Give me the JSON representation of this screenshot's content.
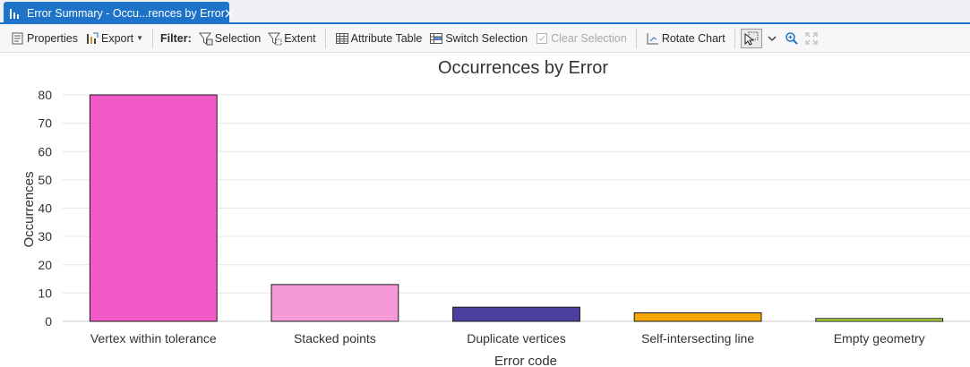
{
  "tab": {
    "title": "Error Summary - Occu...rences by Error",
    "icon": "bar-chart-icon",
    "close_icon": "close-icon"
  },
  "toolbar": {
    "properties_label": "Properties",
    "export_label": "Export",
    "filter_label": "Filter:",
    "selection_label": "Selection",
    "extent_label": "Extent",
    "attribute_table_label": "Attribute Table",
    "switch_selection_label": "Switch Selection",
    "clear_selection_label": "Clear Selection",
    "rotate_chart_label": "Rotate Chart"
  },
  "colors": {
    "accent": "#1e73c8",
    "gridline": "#e6e6e6"
  },
  "chart_data": {
    "type": "bar",
    "title": "Occurrences by Error",
    "xlabel": "Error code",
    "ylabel": "Occurrences",
    "categories": [
      "Vertex within tolerance",
      "Stacked points",
      "Duplicate vertices",
      "Self-intersecting line",
      "Empty geometry"
    ],
    "values": [
      80,
      13,
      5,
      3,
      1
    ],
    "colors": [
      "#f25bc7",
      "#f59ad7",
      "#4b40a0",
      "#f7a704",
      "#b7e23c"
    ],
    "ylim": [
      0,
      80
    ],
    "yticks": [
      0,
      10,
      20,
      30,
      40,
      50,
      60,
      70,
      80
    ],
    "grid": true
  }
}
